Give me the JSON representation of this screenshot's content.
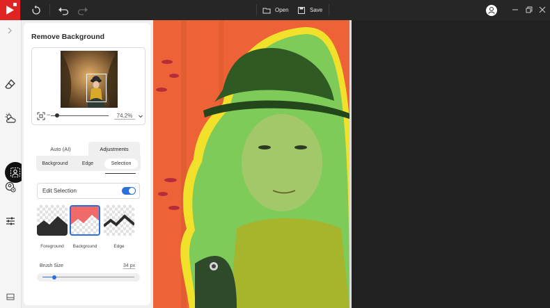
{
  "toolbar": {
    "open_label": "Open",
    "save_label": "Save",
    "icons": [
      "app-logo-icon",
      "reset-icon",
      "undo-icon",
      "redo-icon",
      "folder-open-icon",
      "save-icon",
      "account-icon",
      "minimize-icon",
      "restore-icon",
      "close-icon"
    ]
  },
  "rail": {
    "icons": [
      "expand-chevron-icon",
      "eraser-icon",
      "weather-icon",
      "remove-bg-icon",
      "face-swap-icon",
      "adjust-sliders-icon",
      "gallery-icon"
    ],
    "active": "remove-bg-icon"
  },
  "panel": {
    "title": "Remove Background",
    "zoom": "74.2%",
    "tabs": [
      {
        "label": "Auto (AI)",
        "active": false
      },
      {
        "label": "Adjustments",
        "active": true
      }
    ],
    "subtabs": [
      {
        "label": "Background",
        "active": false
      },
      {
        "label": "Edge",
        "active": false
      },
      {
        "label": "Selection",
        "active": true
      }
    ],
    "edit_selection": {
      "label": "Edit Selection",
      "enabled": true
    },
    "brush_modes": [
      {
        "label": "Foreground",
        "active": false
      },
      {
        "label": "Background",
        "active": true
      },
      {
        "label": "Edge",
        "active": false
      }
    ],
    "brush_size": {
      "label": "Brush Size",
      "value": "34 px",
      "fraction": 0.13
    }
  },
  "colors": {
    "accent": "#2a6fdb",
    "brand": "#e02424",
    "foreground_mask": "#7ecb5a",
    "background_mask": "#f05a32",
    "edge_mask": "#f2e12a"
  }
}
